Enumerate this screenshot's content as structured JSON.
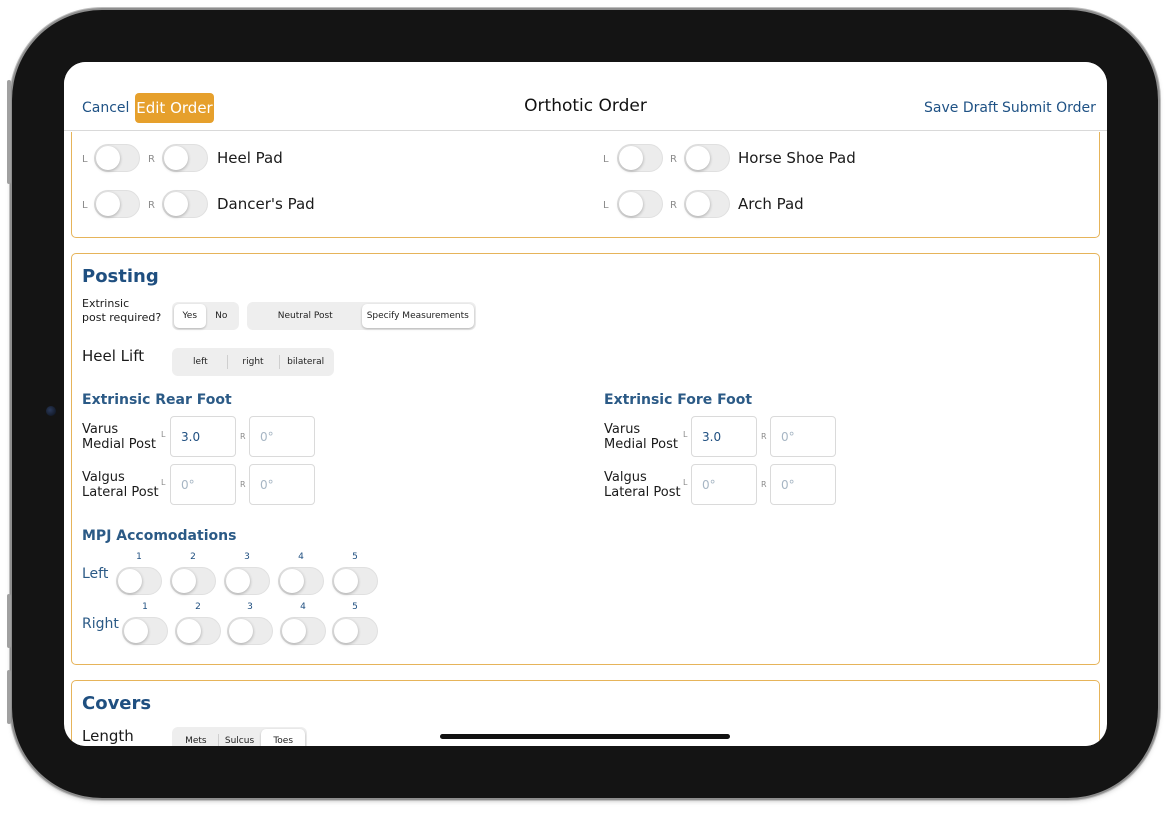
{
  "nav": {
    "cancel": "Cancel",
    "edit_order": "Edit Order",
    "title": "Orthotic Order",
    "save_draft": "Save Draft",
    "submit_order": "Submit Order"
  },
  "pads": {
    "l": "L",
    "r": "R",
    "items": [
      "Heel Pad",
      "Horse Shoe Pad",
      "Dancer's Pad",
      "Arch Pad"
    ]
  },
  "posting": {
    "title": "Posting",
    "extrinsic_label_1": "Extrinsic",
    "extrinsic_label_2": "post required?",
    "yes": "Yes",
    "no": "No",
    "neutral_post": "Neutral Post",
    "specify": "Specify Measurements",
    "heel_lift": "Heel Lift",
    "heel_options": [
      "left",
      "right",
      "bilateral"
    ],
    "rear_title": "Extrinsic Rear Foot",
    "fore_title": "Extrinsic Fore Foot",
    "varus_1": "Varus",
    "varus_2": "Medial Post",
    "valgus_1": "Valgus",
    "valgus_2": "Lateral Post",
    "rear": {
      "varus_l": "3.0",
      "varus_r": "0°",
      "valgus_l": "0°",
      "valgus_r": "0°"
    },
    "fore": {
      "varus_l": "3.0",
      "varus_r": "0°",
      "valgus_l": "0°",
      "valgus_r": "0°"
    },
    "mpj_title": "MPJ Accomodations",
    "left": "Left",
    "right": "Right",
    "numbers": [
      "1",
      "2",
      "3",
      "4",
      "5"
    ]
  },
  "covers": {
    "title": "Covers",
    "length": "Length",
    "options": [
      "Mets",
      "Sulcus",
      "Toes"
    ]
  }
}
